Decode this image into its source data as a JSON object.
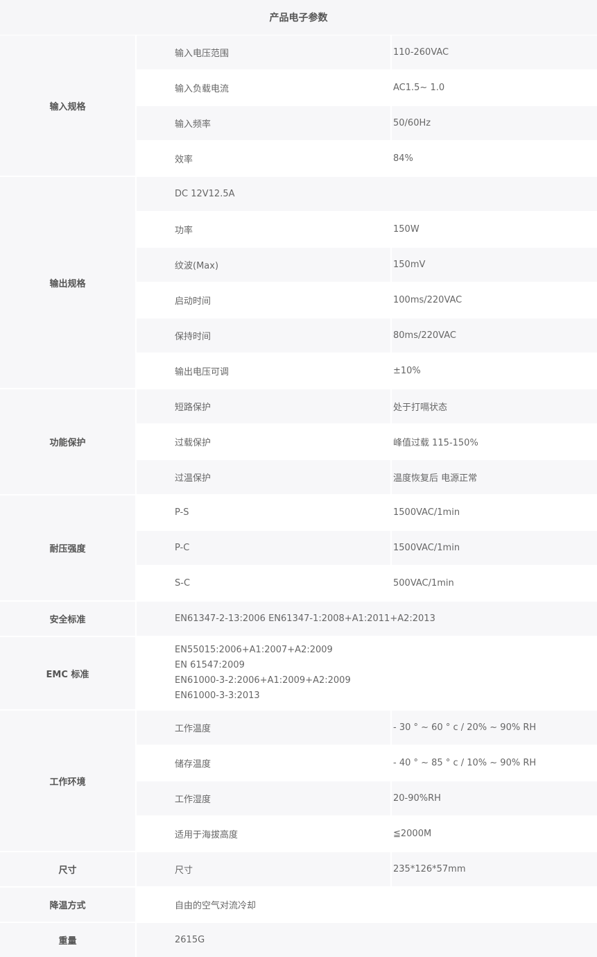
{
  "title": "产品电子参数",
  "sections": [
    {
      "category": "输入规格",
      "rows": [
        {
          "name": "输入电压范围",
          "value": "110-260VAC"
        },
        {
          "name": "输入负载电流",
          "value": "AC1.5~ 1.0"
        },
        {
          "name": "输入频率",
          "value": "50/60Hz"
        },
        {
          "name": "效率",
          "value": "84%"
        }
      ]
    },
    {
      "category": "输出规格",
      "rows": [
        {
          "full": "DC 12V12.5A"
        },
        {
          "name": "功率",
          "value": "150W"
        },
        {
          "name": "纹波(Max)",
          "value": "150mV"
        },
        {
          "name": "启动时间",
          "value": "100ms/220VAC"
        },
        {
          "name": "保持时间",
          "value": "80ms/220VAC"
        },
        {
          "name": "输出电压可调",
          "value": "±10%"
        }
      ]
    },
    {
      "category": "功能保护",
      "rows": [
        {
          "name": "短路保护",
          "value": "处于打嗝状态"
        },
        {
          "name": "过载保护",
          "value": "峰值过载 115-150%"
        },
        {
          "name": "过温保护",
          "value": "温度恢复后 电源正常"
        }
      ]
    },
    {
      "category": "耐压强度",
      "rows": [
        {
          "name": "P-S",
          "value": "1500VAC/1min"
        },
        {
          "name": "P-C",
          "value": "1500VAC/1min"
        },
        {
          "name": "S-C",
          "value": "500VAC/1min"
        }
      ]
    },
    {
      "category": "安全标准",
      "rows": [
        {
          "full": "EN61347-2-13:2006  EN61347-1:2008+A1:2011+A2:2013"
        }
      ]
    },
    {
      "category": "EMC 标准",
      "rows": [
        {
          "lines": [
            "EN55015:2006+A1:2007+A2:2009",
            "EN 61547:2009",
            "EN61000-3-2:2006+A1:2009+A2:2009",
            "EN61000-3-3:2013"
          ]
        }
      ]
    },
    {
      "category": "工作环境",
      "rows": [
        {
          "name": "工作温度",
          "value": "- 30 ° ~ 60 ° c / 20% ~ 90% RH"
        },
        {
          "name": "储存温度",
          "value": "- 40 ° ~ 85 ° c / 10% ~ 90% RH"
        },
        {
          "name": "工作湿度",
          "value": "20-90%RH"
        },
        {
          "name": "适用于海拔高度",
          "value": "≦2000M"
        }
      ]
    },
    {
      "category": "尺寸",
      "rows": [
        {
          "name": "尺寸",
          "value": "235*126*57mm"
        }
      ]
    },
    {
      "category": "降温方式",
      "rows": [
        {
          "full": " 自由的空气对流冷却"
        }
      ]
    },
    {
      "category": "重量",
      "rows": [
        {
          "full": "2615G"
        }
      ]
    }
  ]
}
